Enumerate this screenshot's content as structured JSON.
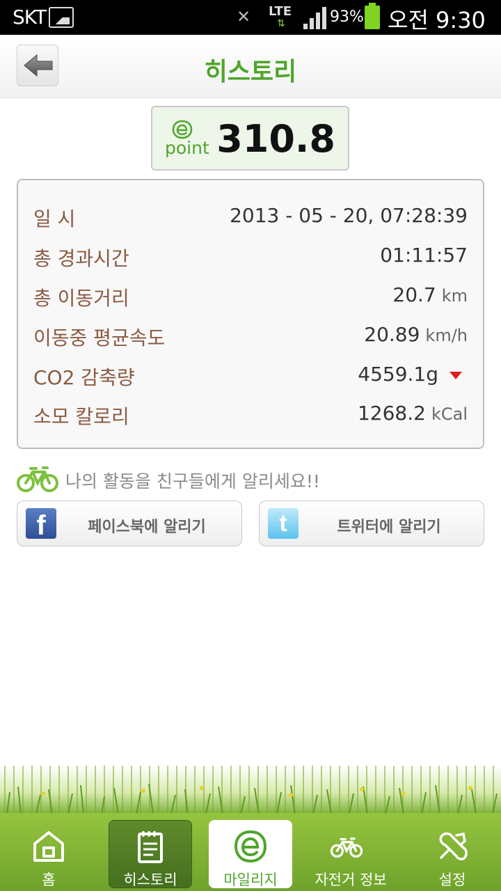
{
  "status_bar": {
    "carrier": "SKT",
    "network": "LTE",
    "battery": "93%",
    "time": "오전 9:30"
  },
  "header": {
    "title": "히스토리",
    "back_icon": "back-arrow-icon"
  },
  "point": {
    "logo_word": "point",
    "value": "310.8",
    "accent_color": "#4ea52a"
  },
  "history": {
    "rows": [
      {
        "label": "일  시",
        "value": "2013 - 05 - 20, 07:28:39",
        "unit": ""
      },
      {
        "label": "총 경과시간",
        "value": "01:11:57",
        "unit": ""
      },
      {
        "label": "총 이동거리",
        "value": "20.7",
        "unit": "km"
      },
      {
        "label": "이동중 평균속도",
        "value": "20.89",
        "unit": "km/h"
      },
      {
        "label": "CO2 감축량",
        "value": "4559.1g",
        "unit": ""
      },
      {
        "label": "소모 칼로리",
        "value": "1268.2",
        "unit": "kCal"
      }
    ],
    "label_color": "#8a5a42",
    "co2_indicator_color": "#e31b1b"
  },
  "share": {
    "prompt": "나의 활동을 친구들에게 알리세요!!",
    "facebook_label": "페이스북에 알리기",
    "twitter_label": "트위터에 알리기"
  },
  "nav": {
    "items": [
      {
        "label": "홈",
        "icon": "home-icon"
      },
      {
        "label": "히스토리",
        "icon": "notepad-icon"
      },
      {
        "label": "마일리지",
        "icon": "e-leaf-icon"
      },
      {
        "label": "자전거 정보",
        "icon": "bicycle-icon"
      },
      {
        "label": "설정",
        "icon": "wrench-icon"
      }
    ],
    "bar_color": "#8bbd3b"
  }
}
